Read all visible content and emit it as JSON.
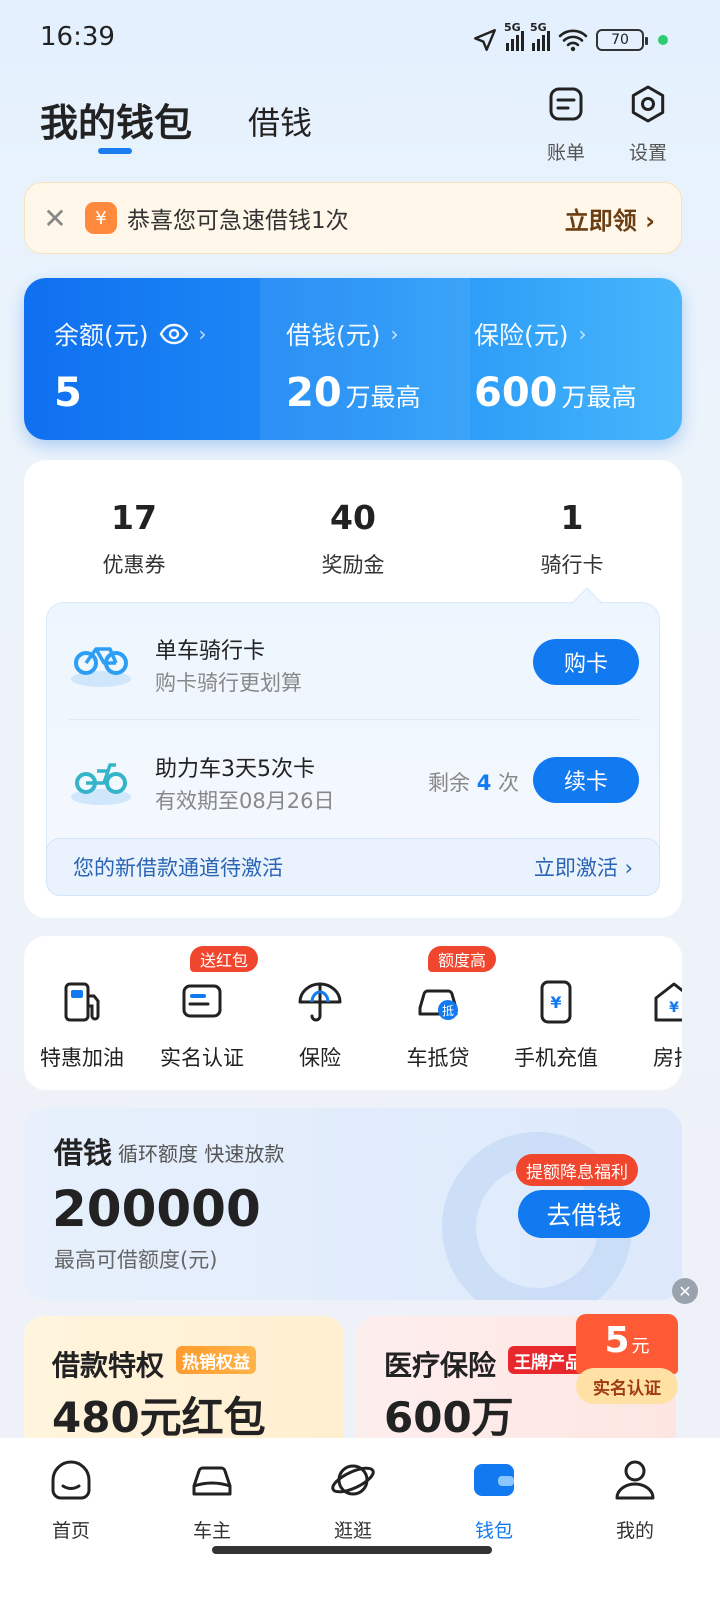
{
  "status_bar": {
    "time": "16:39",
    "network_1": "5G",
    "network_2": "5G",
    "battery": "70"
  },
  "header": {
    "tab_wallet": "我的钱包",
    "tab_borrow": "借钱",
    "bill_label": "账单",
    "settings_label": "设置"
  },
  "notice": {
    "message": "恭喜您可急速借钱1次",
    "cta": "立即领"
  },
  "summary": {
    "balance_label": "余额(元)",
    "balance_value": "5",
    "borrow_label": "借钱(元)",
    "borrow_value": "20",
    "borrow_unit": "万最高",
    "insurance_label": "保险(元)",
    "insurance_value": "600",
    "insurance_unit": "万最高"
  },
  "stats": [
    {
      "value": "17",
      "label": "优惠券"
    },
    {
      "value": "40",
      "label": "奖励金"
    },
    {
      "value": "1",
      "label": "骑行卡"
    }
  ],
  "ride_cards": [
    {
      "title": "单车骑行卡",
      "subtitle": "购卡骑行更划算",
      "button": "购卡"
    },
    {
      "title": "助力车3天5次卡",
      "subtitle": "有效期至08月26日",
      "remain_prefix": "剩余",
      "remain_count": "4",
      "remain_suffix": "次",
      "button": "续卡"
    }
  ],
  "activate": {
    "text": "您的新借款通道待激活",
    "cta": "立即激活"
  },
  "services": [
    {
      "label": "特惠加油",
      "icon": "fuel-pump-icon"
    },
    {
      "label": "实名认证",
      "icon": "id-card-icon",
      "badge": "送红包"
    },
    {
      "label": "保险",
      "icon": "umbrella-icon"
    },
    {
      "label": "车抵贷",
      "icon": "car-loan-icon",
      "badge": "额度高"
    },
    {
      "label": "手机充值",
      "icon": "phone-topup-icon"
    },
    {
      "label": "房抵",
      "icon": "house-loan-icon"
    }
  ],
  "loan": {
    "title": "借钱",
    "tags": "循环额度 快速放款",
    "amount": "200000",
    "subtitle": "最高可借额度(元)",
    "badge": "提额降息福利",
    "button": "去借钱"
  },
  "promos": [
    {
      "title": "借款特权",
      "tag": "热销权益",
      "value": "480元红包"
    },
    {
      "title": "医疗保险",
      "tag": "王牌产品",
      "value": "600万"
    }
  ],
  "coupon": {
    "amount": "5",
    "unit": "元",
    "label": "实名认证"
  },
  "bottom_nav": [
    {
      "label": "首页",
      "icon": "home-icon"
    },
    {
      "label": "车主",
      "icon": "car-icon"
    },
    {
      "label": "逛逛",
      "icon": "planet-icon"
    },
    {
      "label": "钱包",
      "icon": "wallet-icon",
      "active": true
    },
    {
      "label": "我的",
      "icon": "person-icon"
    }
  ],
  "colors": {
    "accent": "#127af0",
    "badge_red": "#f0462e",
    "active_nav": "#127af0"
  }
}
